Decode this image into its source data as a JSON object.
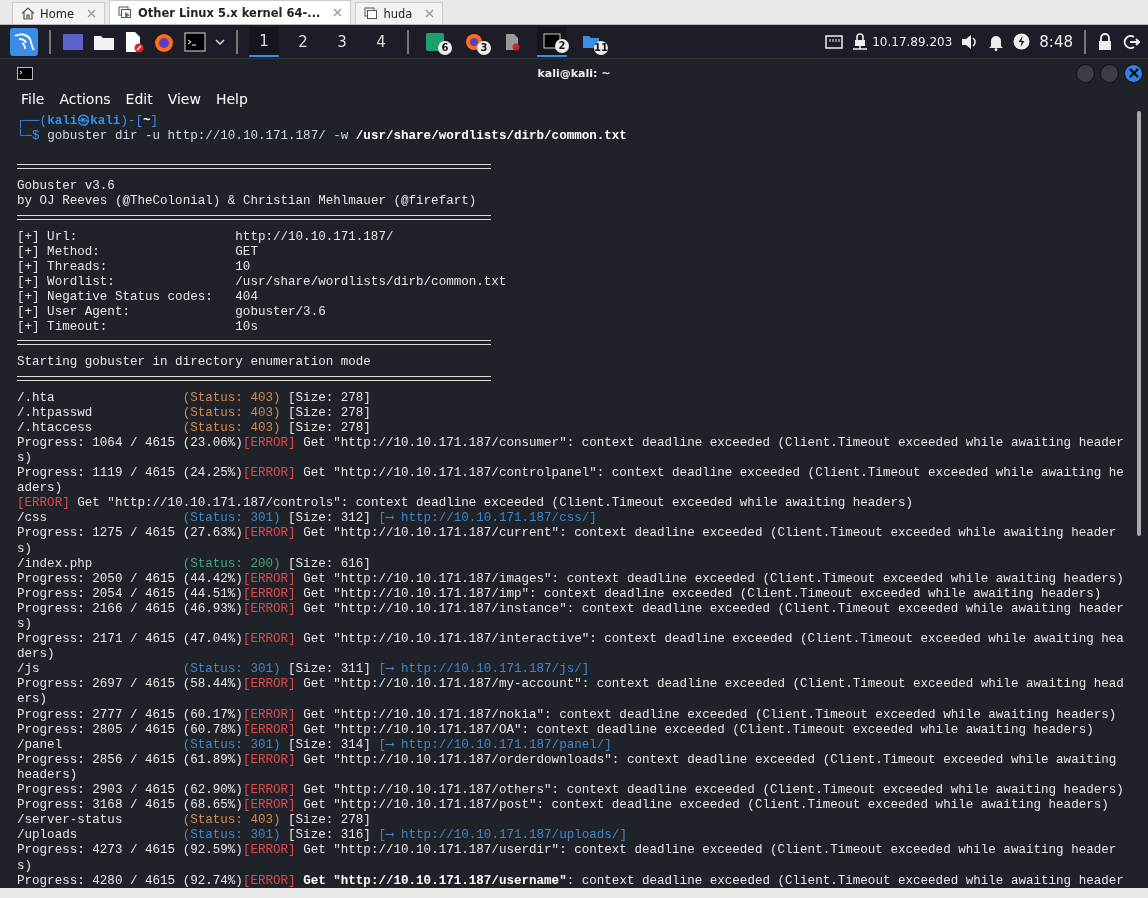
{
  "vm_tabs": [
    {
      "label": "Home",
      "kind": "home",
      "selected": false
    },
    {
      "label": "Other Linux 5.x kernel 64-...",
      "kind": "vm-running",
      "selected": true
    },
    {
      "label": "huda",
      "kind": "vm",
      "selected": false
    }
  ],
  "panel": {
    "workspaces": [
      {
        "label": "1",
        "selected": true
      },
      {
        "label": "2",
        "selected": false
      },
      {
        "label": "3",
        "selected": false
      },
      {
        "label": "4",
        "selected": false
      }
    ],
    "tasks": [
      {
        "kind": "terminal-green",
        "badge": "6",
        "active": false
      },
      {
        "kind": "firefox",
        "badge": "3",
        "active": false
      },
      {
        "kind": "document",
        "active": false
      },
      {
        "kind": "terminal",
        "badge": "2",
        "active": true
      },
      {
        "kind": "folder",
        "badge": "11",
        "active": false
      }
    ],
    "ip": "10.17.89.203",
    "clock": "8:48"
  },
  "terminal": {
    "title": "kali@kali: ~",
    "menu": [
      "File",
      "Actions",
      "Edit",
      "View",
      "Help"
    ],
    "lines": [
      {
        "kind": "line",
        "segments": [
          {
            "kind": "frame",
            "text": "┌──("
          },
          {
            "kind": "user",
            "text": "kali㉿kali"
          },
          {
            "kind": "frame",
            "text": ")-["
          },
          {
            "kind": "dir",
            "text": "~"
          },
          {
            "kind": "frame",
            "text": "]"
          }
        ]
      },
      {
        "kind": "line",
        "segments": [
          {
            "kind": "frame",
            "text": "└─$ "
          },
          {
            "kind": "cmd",
            "text": "gobuster dir -u http://10.10.171.187/ -w "
          },
          {
            "kind": "bold",
            "text": "/usr/share/wordlists/dirb/common.txt"
          }
        ]
      },
      {
        "kind": "blank"
      },
      {
        "kind": "rule"
      },
      {
        "kind": "line",
        "segments": [
          {
            "kind": "plain",
            "text": "Gobuster v3.6"
          }
        ]
      },
      {
        "kind": "line",
        "segments": [
          {
            "kind": "plain",
            "text": "by OJ Reeves (@TheColonial) & Christian Mehlmauer (@firefart)"
          }
        ]
      },
      {
        "kind": "rule"
      },
      {
        "kind": "line",
        "segments": [
          {
            "kind": "label",
            "text": "[+] Url:"
          },
          {
            "kind": "plain",
            "text": "http://10.10.171.187/"
          }
        ]
      },
      {
        "kind": "line",
        "segments": [
          {
            "kind": "label",
            "text": "[+] Method:"
          },
          {
            "kind": "plain",
            "text": "GET"
          }
        ]
      },
      {
        "kind": "line",
        "segments": [
          {
            "kind": "label",
            "text": "[+] Threads:"
          },
          {
            "kind": "plain",
            "text": "10"
          }
        ]
      },
      {
        "kind": "line",
        "segments": [
          {
            "kind": "label",
            "text": "[+] Wordlist:"
          },
          {
            "kind": "plain",
            "text": "/usr/share/wordlists/dirb/common.txt"
          }
        ]
      },
      {
        "kind": "line",
        "segments": [
          {
            "kind": "label",
            "text": "[+] Negative Status codes:"
          },
          {
            "kind": "plain",
            "text": "404"
          }
        ]
      },
      {
        "kind": "line",
        "segments": [
          {
            "kind": "label",
            "text": "[+] User Agent:"
          },
          {
            "kind": "plain",
            "text": "gobuster/3.6"
          }
        ]
      },
      {
        "kind": "line",
        "segments": [
          {
            "kind": "label",
            "text": "[+] Timeout:"
          },
          {
            "kind": "plain",
            "text": "10s"
          }
        ]
      },
      {
        "kind": "rule"
      },
      {
        "kind": "line",
        "segments": [
          {
            "kind": "plain",
            "text": "Starting gobuster in directory enumeration mode"
          }
        ]
      },
      {
        "kind": "rule"
      },
      {
        "kind": "line",
        "segments": [
          {
            "kind": "path",
            "text": "/.hta"
          },
          {
            "kind": "status",
            "text": "(Status: 403)",
            "color": "#d4894a"
          },
          {
            "kind": "plain",
            "text": " [Size: 278]"
          }
        ]
      },
      {
        "kind": "line",
        "segments": [
          {
            "kind": "path",
            "text": "/.htpasswd"
          },
          {
            "kind": "status",
            "text": "(Status: 403)",
            "color": "#d4894a"
          },
          {
            "kind": "plain",
            "text": " [Size: 278]"
          }
        ]
      },
      {
        "kind": "line",
        "segments": [
          {
            "kind": "path",
            "text": "/.htaccess"
          },
          {
            "kind": "status",
            "text": "(Status: 403)",
            "color": "#d4894a"
          },
          {
            "kind": "plain",
            "text": " [Size: 278]"
          }
        ]
      },
      {
        "kind": "line",
        "segments": [
          {
            "kind": "plain",
            "text": "Progress: 1064 / 4615 (23.06%)"
          },
          {
            "kind": "error",
            "text": "[ERROR]"
          },
          {
            "kind": "plain",
            "text": " Get \"http://10.10.171.187/consumer\": context deadline exceeded (Client.Timeout exceeded while awaiting headers)"
          }
        ]
      },
      {
        "kind": "line",
        "segments": [
          {
            "kind": "plain",
            "text": "Progress: 1119 / 4615 (24.25%)"
          },
          {
            "kind": "error",
            "text": "[ERROR]"
          },
          {
            "kind": "plain",
            "text": " Get \"http://10.10.171.187/controlpanel\": context deadline exceeded (Client.Timeout exceeded while awaiting headers)"
          }
        ]
      },
      {
        "kind": "line",
        "segments": [
          {
            "kind": "error",
            "text": "[ERROR]"
          },
          {
            "kind": "plain",
            "text": " Get \"http://10.10.171.187/controls\": context deadline exceeded (Client.Timeout exceeded while awaiting headers)"
          }
        ]
      },
      {
        "kind": "line",
        "segments": [
          {
            "kind": "path",
            "text": "/css"
          },
          {
            "kind": "status",
            "text": "(Status: 301)",
            "color": "#3f87c9"
          },
          {
            "kind": "plain",
            "text": " [Size: 312] "
          },
          {
            "kind": "link",
            "text": "[⟶ http://10.10.171.187/css/]"
          }
        ]
      },
      {
        "kind": "line",
        "segments": [
          {
            "kind": "plain",
            "text": "Progress: 1275 / 4615 (27.63%)"
          },
          {
            "kind": "error",
            "text": "[ERROR]"
          },
          {
            "kind": "plain",
            "text": " Get \"http://10.10.171.187/current\": context deadline exceeded (Client.Timeout exceeded while awaiting headers)"
          }
        ]
      },
      {
        "kind": "line",
        "segments": [
          {
            "kind": "path",
            "text": "/index.php"
          },
          {
            "kind": "status",
            "text": "(Status: 200)",
            "color": "#3fa77a"
          },
          {
            "kind": "plain",
            "text": " [Size: 616]"
          }
        ]
      },
      {
        "kind": "line",
        "segments": [
          {
            "kind": "plain",
            "text": "Progress: 2050 / 4615 (44.42%)"
          },
          {
            "kind": "error",
            "text": "[ERROR]"
          },
          {
            "kind": "plain",
            "text": " Get \"http://10.10.171.187/images\": context deadline exceeded (Client.Timeout exceeded while awaiting headers)"
          }
        ]
      },
      {
        "kind": "line",
        "segments": [
          {
            "kind": "plain",
            "text": "Progress: 2054 / 4615 (44.51%)"
          },
          {
            "kind": "error",
            "text": "[ERROR]"
          },
          {
            "kind": "plain",
            "text": " Get \"http://10.10.171.187/imp\": context deadline exceeded (Client.Timeout exceeded while awaiting headers)"
          }
        ]
      },
      {
        "kind": "line",
        "segments": [
          {
            "kind": "plain",
            "text": "Progress: 2166 / 4615 (46.93%)"
          },
          {
            "kind": "error",
            "text": "[ERROR]"
          },
          {
            "kind": "plain",
            "text": " Get \"http://10.10.171.187/instance\": context deadline exceeded (Client.Timeout exceeded while awaiting headers)"
          }
        ]
      },
      {
        "kind": "line",
        "segments": [
          {
            "kind": "plain",
            "text": "Progress: 2171 / 4615 (47.04%)"
          },
          {
            "kind": "error",
            "text": "[ERROR]"
          },
          {
            "kind": "plain",
            "text": " Get \"http://10.10.171.187/interactive\": context deadline exceeded (Client.Timeout exceeded while awaiting headers)"
          }
        ]
      },
      {
        "kind": "line",
        "segments": [
          {
            "kind": "path",
            "text": "/js"
          },
          {
            "kind": "status",
            "text": "(Status: 301)",
            "color": "#3f87c9"
          },
          {
            "kind": "plain",
            "text": " [Size: 311] "
          },
          {
            "kind": "link",
            "text": "[⟶ http://10.10.171.187/js/]"
          }
        ]
      },
      {
        "kind": "line",
        "segments": [
          {
            "kind": "plain",
            "text": "Progress: 2697 / 4615 (58.44%)"
          },
          {
            "kind": "error",
            "text": "[ERROR]"
          },
          {
            "kind": "plain",
            "text": " Get \"http://10.10.171.187/my-account\": context deadline exceeded (Client.Timeout exceeded while awaiting headers)"
          }
        ]
      },
      {
        "kind": "line",
        "segments": [
          {
            "kind": "plain",
            "text": "Progress: 2777 / 4615 (60.17%)"
          },
          {
            "kind": "error",
            "text": "[ERROR]"
          },
          {
            "kind": "plain",
            "text": " Get \"http://10.10.171.187/nokia\": context deadline exceeded (Client.Timeout exceeded while awaiting headers)"
          }
        ]
      },
      {
        "kind": "line",
        "segments": [
          {
            "kind": "plain",
            "text": "Progress: 2805 / 4615 (60.78%)"
          },
          {
            "kind": "error",
            "text": "[ERROR]"
          },
          {
            "kind": "plain",
            "text": " Get \"http://10.10.171.187/OA\": context deadline exceeded (Client.Timeout exceeded while awaiting headers)"
          }
        ]
      },
      {
        "kind": "line",
        "segments": [
          {
            "kind": "path",
            "text": "/panel"
          },
          {
            "kind": "status",
            "text": "(Status: 301)",
            "color": "#3f87c9"
          },
          {
            "kind": "plain",
            "text": " [Size: 314] "
          },
          {
            "kind": "link",
            "text": "[⟶ http://10.10.171.187/panel/]"
          }
        ]
      },
      {
        "kind": "line",
        "segments": [
          {
            "kind": "plain",
            "text": "Progress: 2856 / 4615 (61.89%)"
          },
          {
            "kind": "error",
            "text": "[ERROR]"
          },
          {
            "kind": "plain",
            "text": " Get \"http://10.10.171.187/orderdownloads\": context deadline exceeded (Client.Timeout exceeded while awaiting headers)"
          }
        ]
      },
      {
        "kind": "line",
        "segments": [
          {
            "kind": "plain",
            "text": "Progress: 2903 / 4615 (62.90%)"
          },
          {
            "kind": "error",
            "text": "[ERROR]"
          },
          {
            "kind": "plain",
            "text": " Get \"http://10.10.171.187/others\": context deadline exceeded (Client.Timeout exceeded while awaiting headers)"
          }
        ]
      },
      {
        "kind": "line",
        "segments": [
          {
            "kind": "plain",
            "text": "Progress: 3168 / 4615 (68.65%)"
          },
          {
            "kind": "error",
            "text": "[ERROR]"
          },
          {
            "kind": "plain",
            "text": " Get \"http://10.10.171.187/post\": context deadline exceeded (Client.Timeout exceeded while awaiting headers)"
          }
        ]
      },
      {
        "kind": "line",
        "segments": [
          {
            "kind": "path",
            "text": "/server-status"
          },
          {
            "kind": "status",
            "text": "(Status: 403)",
            "color": "#d4894a"
          },
          {
            "kind": "plain",
            "text": " [Size: 278]"
          }
        ]
      },
      {
        "kind": "line",
        "segments": [
          {
            "kind": "path",
            "text": "/uploads"
          },
          {
            "kind": "status",
            "text": "(Status: 301)",
            "color": "#3f87c9"
          },
          {
            "kind": "plain",
            "text": " [Size: 316] "
          },
          {
            "kind": "link",
            "text": "[⟶ http://10.10.171.187/uploads/]"
          }
        ]
      },
      {
        "kind": "line",
        "segments": [
          {
            "kind": "plain",
            "text": "Progress: 4273 / 4615 (92.59%)"
          },
          {
            "kind": "error",
            "text": "[ERROR]"
          },
          {
            "kind": "plain",
            "text": " Get \"http://10.10.171.187/userdir\": context deadline exceeded (Client.Timeout exceeded while awaiting headers)"
          }
        ]
      },
      {
        "kind": "line",
        "segments": [
          {
            "kind": "plain",
            "text": "Progress: 4280 / 4615 (92.74%)"
          },
          {
            "kind": "error",
            "text": "[ERROR]"
          },
          {
            "kind": "bold",
            "text": " Get \"http://10.10.171.187/username\""
          },
          {
            "kind": "plain",
            "text": ": context deadline exceeded (Client.Timeout exceeded while awaiting header"
          }
        ]
      }
    ]
  }
}
